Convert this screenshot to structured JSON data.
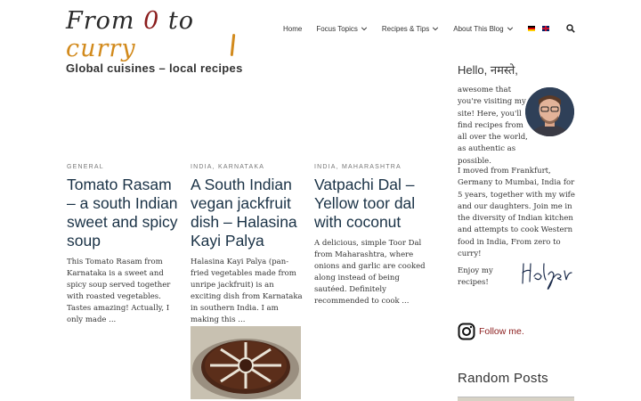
{
  "logo": {
    "part1": "From ",
    "zero": "0",
    "part2": " to ",
    "curry": "curry"
  },
  "nav": {
    "items": [
      {
        "label": "Home"
      },
      {
        "label": "Focus Topics"
      },
      {
        "label": "Recipes & Tips"
      },
      {
        "label": "About This Blog"
      }
    ]
  },
  "page": {
    "title": "Global cuisines – local recipes"
  },
  "posts": [
    {
      "category": "GENERAL",
      "title": "Tomato Rasam – a south Indian sweet and spicy soup",
      "excerpt": "This Tomato Rasam from Karnataka is a sweet and spicy soup served together with roasted vegetables. Tastes amazing! Actually, I only made ..."
    },
    {
      "category": "INDIA, KARNATAKA",
      "title": "A South Indian vegan jackfruit dish – Halasina Kayi Palya",
      "excerpt": "Halasina Kayi Palya (pan-fried vegetables made from unripe jackfruit) is an exciting dish from Karnataka in southern India. I am making this ..."
    },
    {
      "category": "INDIA, MAHARASHTRA",
      "title": "Vatpachi Dal – Yellow toor dal with coconut",
      "excerpt": "A delicious, simple Toor Dal from Maharashtra, where onions and garlic are cooked along instead of being sautéed. Definitely recommended to cook ..."
    }
  ],
  "sidebar": {
    "hello": "Hello, नमस्ते,",
    "intro": "awesome that you're visiting my site! Here, you'll find recipes from all over the world, as authentic as possible.",
    "bio": "I moved from Frankfurt, Germany to Mumbai, India for 5 years, together with my wife and our daughters. Join me in the diversity of Indian kitchen and attempts to cook Western food in India, From zero to curry!",
    "enjoy": "Enjoy my recipes!",
    "follow": "Follow me.",
    "random_title": "Random Posts"
  },
  "colors": {
    "accent": "#8b1d1d",
    "title": "#1a3246",
    "curry": "#d28a1c"
  },
  "icons": {
    "search": "search-icon",
    "instagram": "instagram-icon",
    "chevron": "chevron-down-icon"
  }
}
